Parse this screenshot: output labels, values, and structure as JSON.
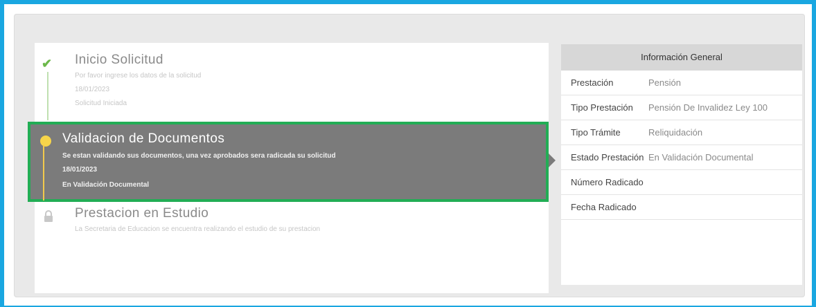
{
  "steps": [
    {
      "title": "Inicio Solicitud",
      "description": "Por favor ingrese los datos de la solicitud",
      "date": "18/01/2023",
      "status": "Solicitud Iniciada",
      "state": "completed",
      "icon": "check-icon"
    },
    {
      "title": "Validacion de Documentos",
      "description": "Se estan validando sus documentos, una vez aprobados sera radicada su solicitud",
      "date": "18/01/2023",
      "status": "En Validación Documental",
      "state": "current",
      "icon": "current-dot-icon"
    },
    {
      "title": "Prestacion en Estudio",
      "description": "La Secretaria de Educacion se encuentra realizando el estudio de su prestacion",
      "state": "locked",
      "icon": "lock-icon"
    }
  ],
  "info": {
    "header": "Información General",
    "rows": [
      {
        "label": "Prestación",
        "value": "Pensión"
      },
      {
        "label": "Tipo Prestación",
        "value": "Pensión De Invalidez Ley 100"
      },
      {
        "label": "Tipo Trámite",
        "value": "Reliquidación"
      },
      {
        "label": "Estado Prestación",
        "value": "En Validación Documental"
      },
      {
        "label": "Número Radicado",
        "value": ""
      },
      {
        "label": "Fecha Radicado",
        "value": ""
      }
    ]
  },
  "colors": {
    "frame": "#1aa7e1",
    "highlight": "#22ad55",
    "current_bg": "#7b7b7b",
    "check": "#6cb84a",
    "dot": "#f7d54a"
  }
}
